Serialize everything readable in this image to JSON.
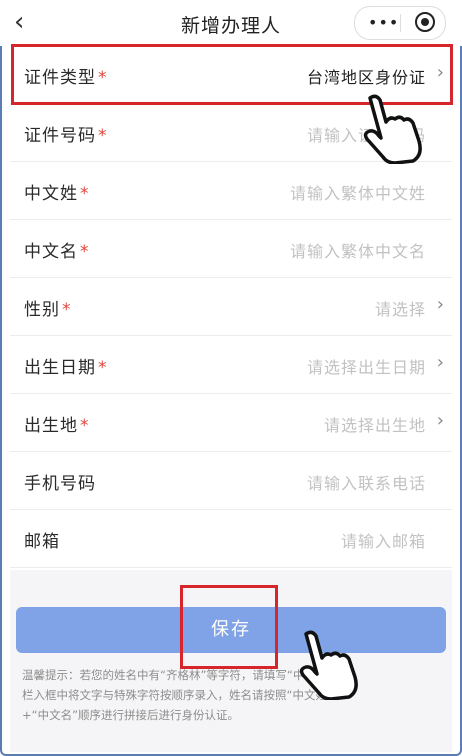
{
  "header": {
    "back_icon": "‹",
    "title": "新增办理人",
    "more_icon": "•••"
  },
  "form": {
    "fields": [
      {
        "label": "证件类型",
        "required": "*",
        "value": "台湾地区身份证",
        "selected": true,
        "chevron": "›"
      },
      {
        "label": "证件号码",
        "required": "*",
        "value": "请输入证件号码",
        "selected": false,
        "chevron": ""
      },
      {
        "label": "中文姓",
        "required": "*",
        "value": "请输入繁体中文姓",
        "selected": false,
        "chevron": ""
      },
      {
        "label": "中文名",
        "required": "*",
        "value": "请输入繁体中文名",
        "selected": false,
        "chevron": ""
      },
      {
        "label": "性别",
        "required": "*",
        "value": "请选择",
        "selected": false,
        "chevron": "›"
      },
      {
        "label": "出生日期",
        "required": "*",
        "value": "请选择出生日期",
        "selected": false,
        "chevron": "›"
      },
      {
        "label": "出生地",
        "required": "*",
        "value": "请选择出生地",
        "selected": false,
        "chevron": "›"
      },
      {
        "label": "手机号码",
        "required": "",
        "value": "请输入联系电话",
        "selected": false,
        "chevron": ""
      },
      {
        "label": "邮箱",
        "required": "",
        "value": "请输入邮箱",
        "selected": false,
        "chevron": ""
      }
    ]
  },
  "save_button": {
    "label": "保存"
  },
  "notice": {
    "line1": "温馨提示：若您的姓名中有“齐格林”等字符，请填写“中文名”",
    "line2": "栏入框中将文字与特殊字符按顺序录入，姓名请按照“中文姓”",
    "line3": "+“中文名”顺序进行拼接后进行身份认证。"
  }
}
